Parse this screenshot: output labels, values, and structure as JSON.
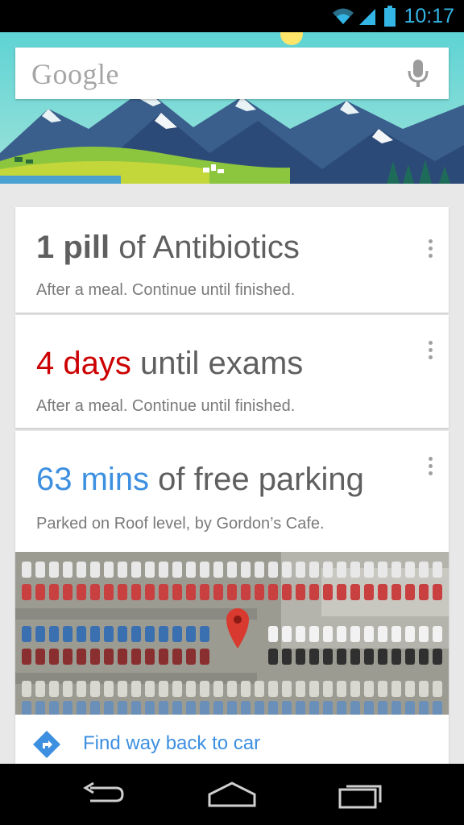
{
  "status_bar": {
    "time": "10:17",
    "icons": [
      "wifi-icon",
      "signal-icon",
      "battery-icon"
    ],
    "accent_color": "#33b5e5"
  },
  "search": {
    "logo_text": "Google",
    "mic_icon": "microphone-icon"
  },
  "cards": {
    "pill": {
      "emphasis": "1 pill",
      "rest": " of Antibiotics",
      "subtitle": "After a meal. Continue until finished."
    },
    "exams": {
      "emphasis": "4 days",
      "rest": " until exams",
      "subtitle": "After a meal. Continue until finished.",
      "emphasis_color": "#cc0000"
    },
    "parking": {
      "emphasis": "63 mins",
      "rest": " of free parking",
      "subtitle": "Parked on Roof level, by Gordon’s Cafe.",
      "emphasis_color": "#3d8fe0",
      "action_label": "Find way back to car",
      "action_icon": "directions-icon"
    }
  },
  "nav_bar": {
    "buttons": [
      "back-icon",
      "home-icon",
      "recent-apps-icon"
    ]
  }
}
